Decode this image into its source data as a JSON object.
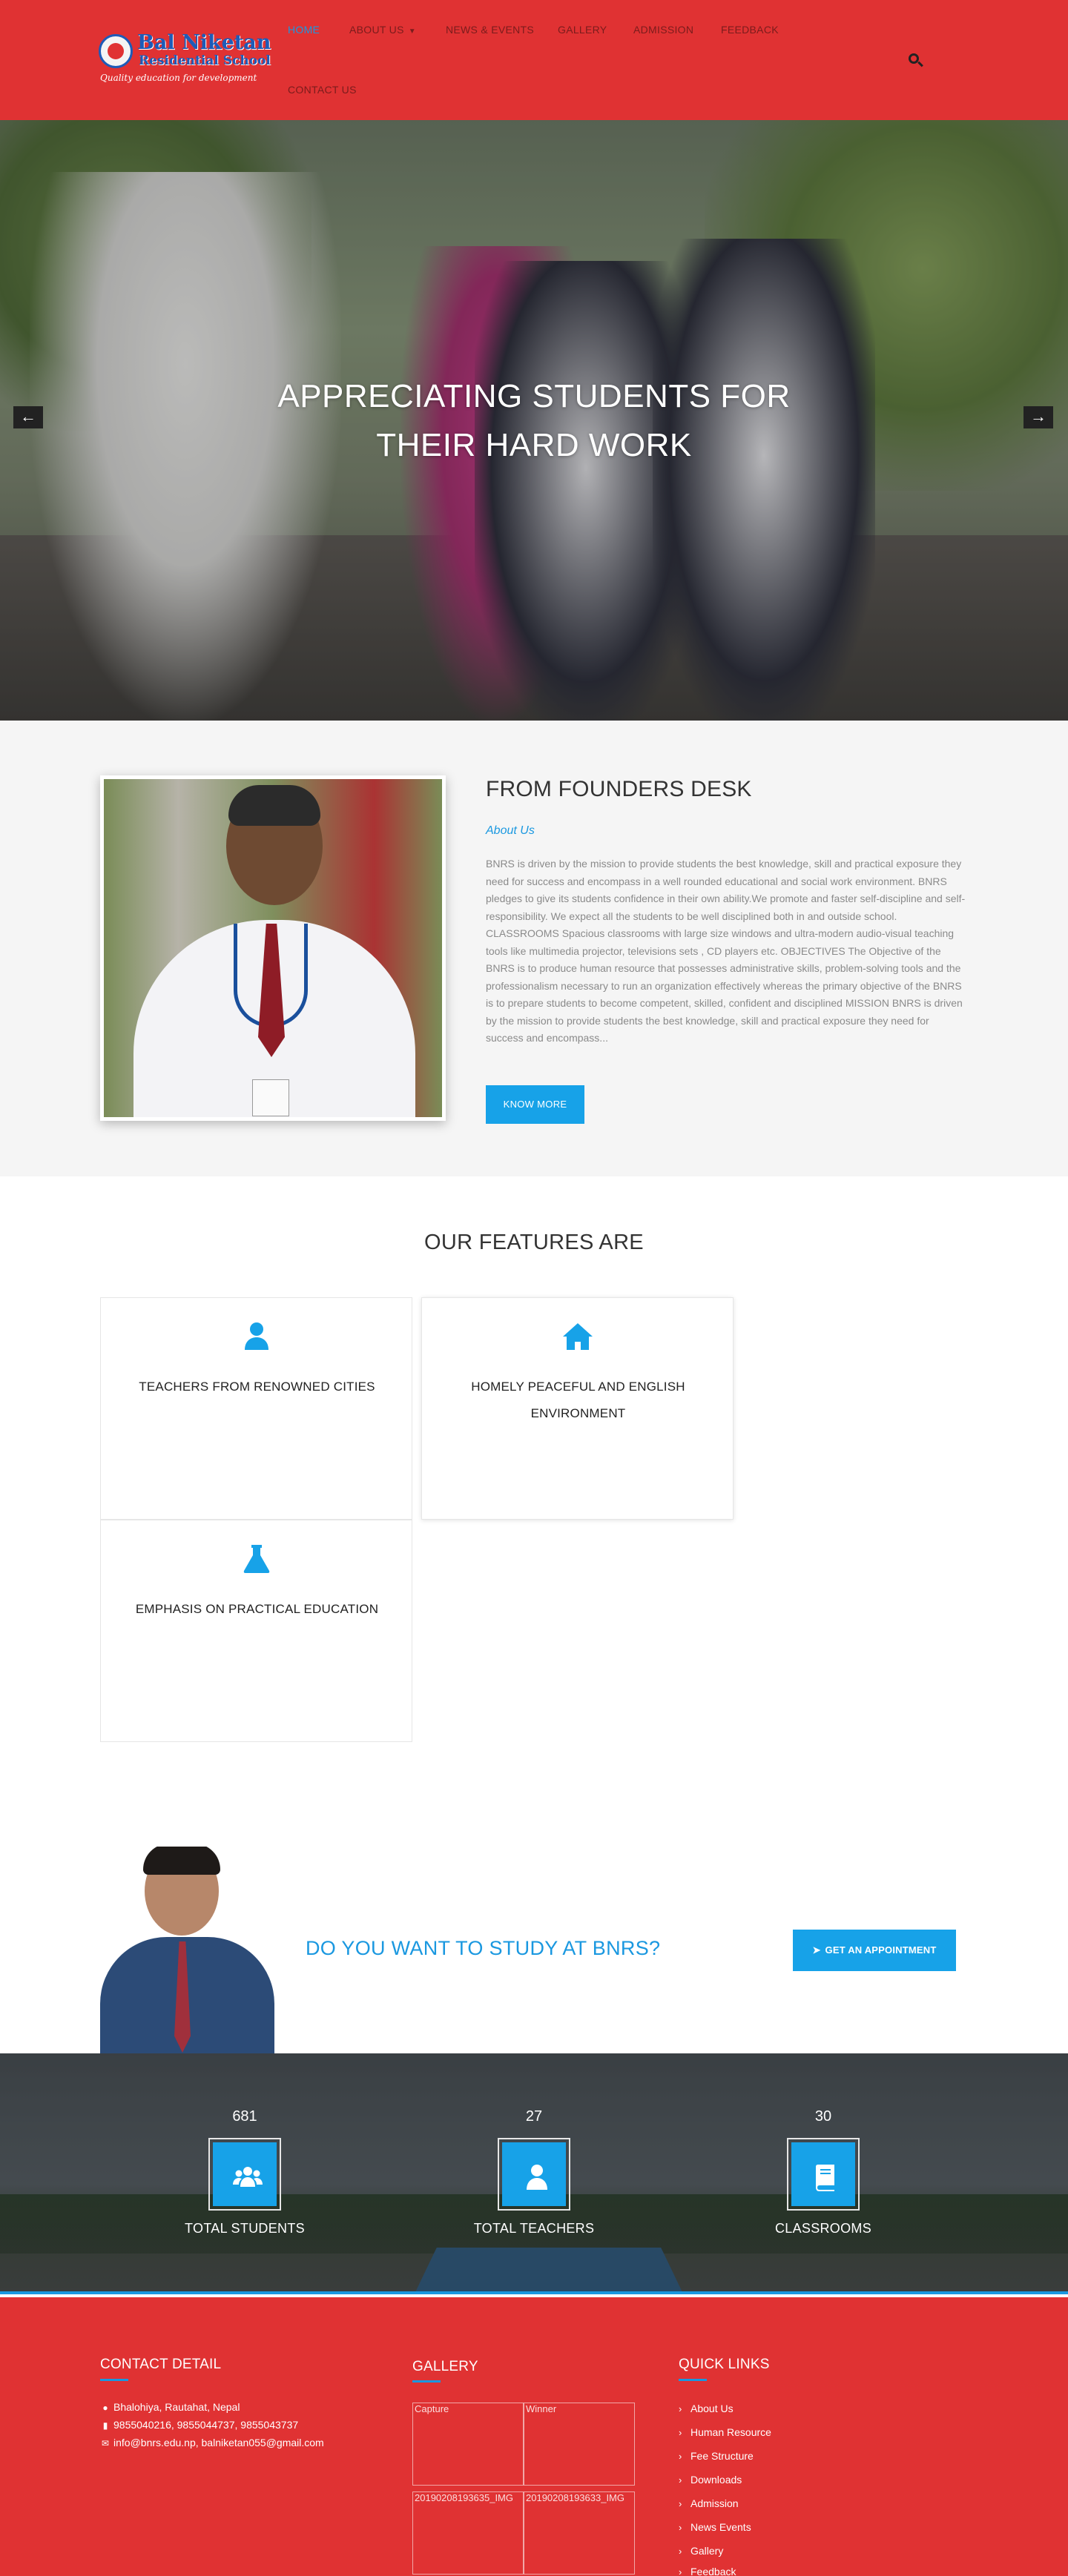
{
  "header": {
    "logo_name": "Bal Niketan",
    "logo_sub": "Residential School",
    "logo_tagline": "Quality education for development",
    "nav": [
      {
        "label": "HOME"
      },
      {
        "label": "ABOUT US"
      },
      {
        "label": "NEWS & EVENTS"
      },
      {
        "label": "GALLERY"
      },
      {
        "label": "ADMISSION"
      },
      {
        "label": "FEEDBACK"
      },
      {
        "label": "CONTACT US"
      }
    ],
    "active_color": "#1a98e0",
    "bg_color": "#e03233"
  },
  "hero": {
    "title_line1": "APPRECIATING STUDENTS FOR",
    "title_line2": "THEIR HARD WORK",
    "prev_icon": "arrow-left-icon",
    "next_icon": "arrow-right-icon"
  },
  "founders": {
    "title": "FROM FOUNDERS DESK",
    "subtitle": "About Us",
    "text": "BNRS is driven by the mission to provide students the best knowledge, skill and practical exposure they need for success and encompass in a well rounded educational and social work environment. BNRS pledges to give its students confidence in their own ability.We promote and faster self-discipline and self-responsibility. We expect all the students to be well disciplined both in and outside school. CLASSROOMS Spacious classrooms with large size windows and ultra-modern audio-visual teaching tools like multimedia projector, televisions sets , CD players etc. OBJECTIVES The Objective of the BNRS is to produce human resource that possesses administrative skills, problem-solving tools and the professionalism necessary to run an organization effectively whereas the primary objective of the BNRS is to prepare students to become competent, skilled, confident and disciplined MISSION BNRS is driven by the mission to provide students the best knowledge, skill and practical exposure they need for success and encompass...",
    "button": "KNOW MORE"
  },
  "features": {
    "title": "OUR FEATURES ARE",
    "items": [
      {
        "label": "TEACHERS FROM RENOWNED CITIES",
        "icon": "user-icon"
      },
      {
        "label": "HOMELY PEACEFUL AND ENGLISH ENVIRONMENT",
        "icon": "home-icon"
      },
      {
        "label": "EMPHASIS ON PRACTICAL EDUCATION",
        "icon": "flask-icon"
      }
    ],
    "accent": "#17a2e8"
  },
  "cta": {
    "text": "DO YOU WANT TO STUDY AT BNRS?",
    "button": "GET AN APPOINTMENT"
  },
  "stats": [
    {
      "value": "681",
      "label": "TOTAL STUDENTS",
      "icon": "users-icon"
    },
    {
      "value": "27",
      "label": "TOTAL TEACHERS",
      "icon": "user-icon"
    },
    {
      "value": "30",
      "label": "CLASSROOMS",
      "icon": "book-icon"
    }
  ],
  "footer": {
    "contact": {
      "title": "CONTACT DETAIL",
      "address": "Bhalohiya, Rautahat, Nepal",
      "phone": "9855040216, 9855044737, 9855043737",
      "email": "info@bnrs.edu.np, balniketan055@gmail.com"
    },
    "gallery": {
      "title": "GALLERY",
      "items": [
        "Capture",
        "Winner",
        "20190208193635_IMG",
        "20190208193633_IMG"
      ]
    },
    "quick_links": {
      "title": "QUICK LINKS",
      "items": [
        "About Us",
        "Human Resource",
        "Fee Structure",
        "Downloads",
        "Admission",
        "News Events",
        "Gallery",
        "Feedback"
      ]
    }
  }
}
